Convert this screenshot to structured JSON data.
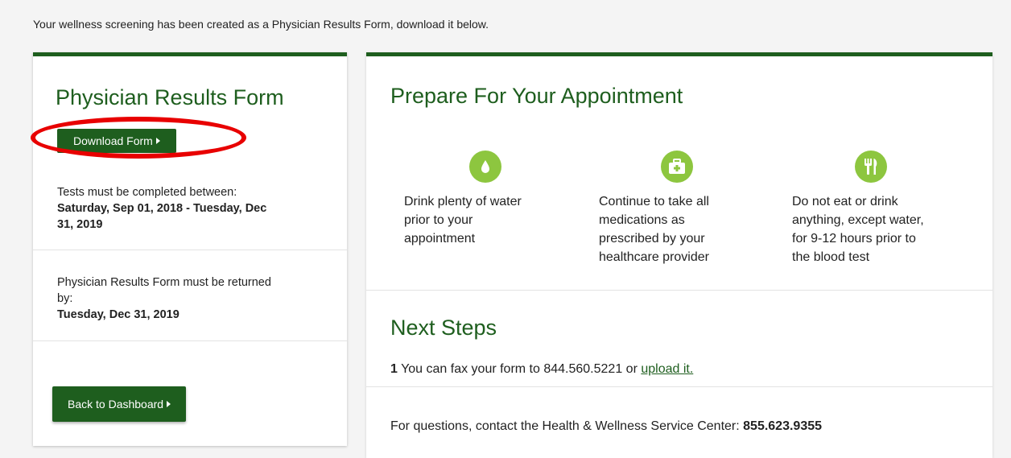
{
  "intro": {
    "text": "Your wellness screening has been created as a Physician Results Form, download it below."
  },
  "left": {
    "title": "Physician Results Form",
    "download_label": "Download Form",
    "tests_label": "Tests must be completed between:",
    "tests_range_line1": "Saturday, Sep 01, 2018 - Tuesday, Dec",
    "tests_range_line2": "31, 2019",
    "return_label_line1": "Physician Results Form must be returned",
    "return_label_line2": "by:",
    "return_date": "Tuesday, Dec 31, 2019",
    "back_label": "Back to Dashboard"
  },
  "right": {
    "prepare_title": "Prepare For Your Appointment",
    "prep_items": [
      {
        "icon": "water-drop-icon",
        "lines": [
          "Drink plenty of water",
          "prior to your",
          "appointment"
        ]
      },
      {
        "icon": "first-aid-kit-icon",
        "lines": [
          "Continue to take all",
          "medications as",
          "prescribed by your",
          "healthcare provider"
        ]
      },
      {
        "icon": "fork-knife-icon",
        "lines": [
          "Do not eat or drink",
          "anything, except water,",
          "for 9-12 hours prior to",
          "the blood test"
        ]
      }
    ],
    "next_title": "Next Steps",
    "step_number": "1",
    "step_text": " You can fax your form to 844.560.5221 or ",
    "step_link": "upload it.",
    "questions_text": "For questions, contact the Health & Wellness Service Center: ",
    "questions_phone": "855.623.9355"
  },
  "colors": {
    "brand_green": "#1e5e1e",
    "icon_green": "#8dc63f",
    "highlight_red": "#e80000"
  }
}
